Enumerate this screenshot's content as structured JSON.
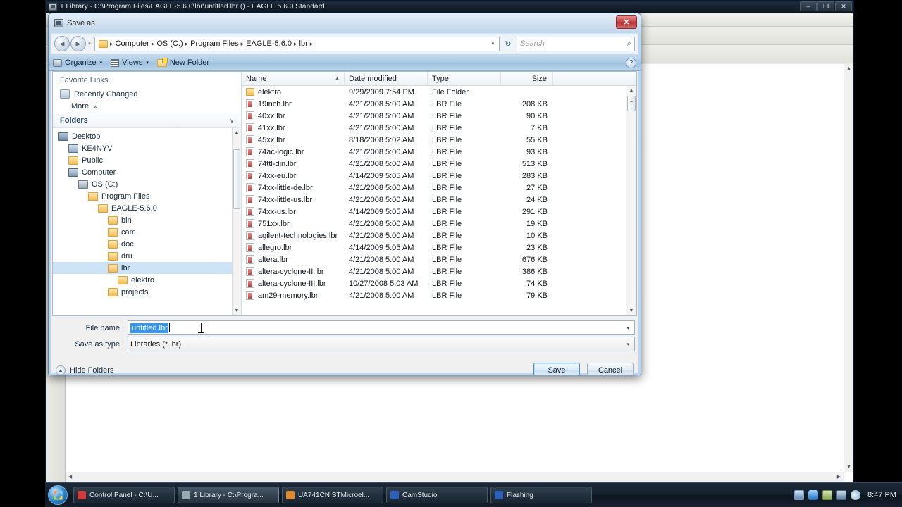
{
  "eagle_window": {
    "title": "1 Library - C:\\Program Files\\EAGLE-5.6.0\\lbr\\untitled.lbr () - EAGLE 5.6.0 Standard",
    "minimize_label": "–",
    "maximize_label": "❐",
    "close_label": "✕"
  },
  "dialog": {
    "title": "Save as",
    "close_label": "✕",
    "nav": {
      "back_label": "◀",
      "forward_label": "▶",
      "history_label": "▾",
      "refresh_label": "↻"
    },
    "breadcrumb": {
      "separator": "▸",
      "items": [
        "Computer",
        "OS (C:)",
        "Program Files",
        "EAGLE-5.6.0",
        "lbr"
      ],
      "dropdown_label": "▾"
    },
    "search": {
      "placeholder": "Search",
      "icon_label": "⌕"
    },
    "commandbar": {
      "organize_label": "Organize",
      "views_label": "Views",
      "new_folder_label": "New Folder",
      "caret_label": "▾",
      "help_label": "?"
    },
    "sidebar": {
      "favorites_header": "Favorite Links",
      "favorites": [
        {
          "label": "Recently Changed"
        }
      ],
      "more_label": "More",
      "more_chevron": "»",
      "folders_header": "Folders",
      "folders_chevron": "∨",
      "tree": [
        {
          "label": "Desktop",
          "depth": 0,
          "icon": "desktop",
          "selected": false
        },
        {
          "label": "KE4NYV",
          "depth": 1,
          "icon": "user",
          "selected": false
        },
        {
          "label": "Public",
          "depth": 1,
          "icon": "folder",
          "selected": false
        },
        {
          "label": "Computer",
          "depth": 1,
          "icon": "computer",
          "selected": false
        },
        {
          "label": "OS (C:)",
          "depth": 2,
          "icon": "drive",
          "selected": false
        },
        {
          "label": "Program Files",
          "depth": 3,
          "icon": "folder",
          "selected": false
        },
        {
          "label": "EAGLE-5.6.0",
          "depth": 4,
          "icon": "folder",
          "selected": false
        },
        {
          "label": "bin",
          "depth": 5,
          "icon": "folder",
          "selected": false
        },
        {
          "label": "cam",
          "depth": 5,
          "icon": "folder",
          "selected": false
        },
        {
          "label": "doc",
          "depth": 5,
          "icon": "folder",
          "selected": false
        },
        {
          "label": "dru",
          "depth": 5,
          "icon": "folder",
          "selected": false
        },
        {
          "label": "lbr",
          "depth": 5,
          "icon": "folder",
          "selected": true
        },
        {
          "label": "elektro",
          "depth": 6,
          "icon": "folder",
          "selected": false
        },
        {
          "label": "projects",
          "depth": 5,
          "icon": "folder",
          "selected": false
        }
      ],
      "scroll_up_label": "▲",
      "scroll_down_label": "▼"
    },
    "filelist": {
      "columns": [
        "Name",
        "Date modified",
        "Type",
        "Size"
      ],
      "sort_indicator": "▲",
      "rows": [
        {
          "name": "elektro",
          "date": "9/29/2009 7:54 PM",
          "type": "File Folder",
          "size": "",
          "icon": "folder"
        },
        {
          "name": "19inch.lbr",
          "date": "4/21/2008 5:00 AM",
          "type": "LBR File",
          "size": "208 KB",
          "icon": "lbr"
        },
        {
          "name": "40xx.lbr",
          "date": "4/21/2008 5:00 AM",
          "type": "LBR File",
          "size": "90 KB",
          "icon": "lbr"
        },
        {
          "name": "41xx.lbr",
          "date": "4/21/2008 5:00 AM",
          "type": "LBR File",
          "size": "7 KB",
          "icon": "lbr"
        },
        {
          "name": "45xx.lbr",
          "date": "8/18/2008 5:02 AM",
          "type": "LBR File",
          "size": "55 KB",
          "icon": "lbr"
        },
        {
          "name": "74ac-logic.lbr",
          "date": "4/21/2008 5:00 AM",
          "type": "LBR File",
          "size": "93 KB",
          "icon": "lbr"
        },
        {
          "name": "74ttl-din.lbr",
          "date": "4/21/2008 5:00 AM",
          "type": "LBR File",
          "size": "513 KB",
          "icon": "lbr"
        },
        {
          "name": "74xx-eu.lbr",
          "date": "4/14/2009 5:05 AM",
          "type": "LBR File",
          "size": "283 KB",
          "icon": "lbr"
        },
        {
          "name": "74xx-little-de.lbr",
          "date": "4/21/2008 5:00 AM",
          "type": "LBR File",
          "size": "27 KB",
          "icon": "lbr"
        },
        {
          "name": "74xx-little-us.lbr",
          "date": "4/21/2008 5:00 AM",
          "type": "LBR File",
          "size": "24 KB",
          "icon": "lbr"
        },
        {
          "name": "74xx-us.lbr",
          "date": "4/14/2009 5:05 AM",
          "type": "LBR File",
          "size": "291 KB",
          "icon": "lbr"
        },
        {
          "name": "751xx.lbr",
          "date": "4/21/2008 5:00 AM",
          "type": "LBR File",
          "size": "19 KB",
          "icon": "lbr"
        },
        {
          "name": "agilent-technologies.lbr",
          "date": "4/21/2008 5:00 AM",
          "type": "LBR File",
          "size": "10 KB",
          "icon": "lbr"
        },
        {
          "name": "allegro.lbr",
          "date": "4/14/2009 5:05 AM",
          "type": "LBR File",
          "size": "23 KB",
          "icon": "lbr"
        },
        {
          "name": "altera.lbr",
          "date": "4/21/2008 5:00 AM",
          "type": "LBR File",
          "size": "676 KB",
          "icon": "lbr"
        },
        {
          "name": "altera-cyclone-II.lbr",
          "date": "4/21/2008 5:00 AM",
          "type": "LBR File",
          "size": "386 KB",
          "icon": "lbr"
        },
        {
          "name": "altera-cyclone-III.lbr",
          "date": "10/27/2008 5:03 AM",
          "type": "LBR File",
          "size": "74 KB",
          "icon": "lbr"
        },
        {
          "name": "am29-memory.lbr",
          "date": "4/21/2008 5:00 AM",
          "type": "LBR File",
          "size": "79 KB",
          "icon": "lbr"
        }
      ],
      "scroll_up_label": "▲",
      "scroll_down_label": "▼"
    },
    "fields": {
      "filename_label": "File name:",
      "filename_value": "untitled.lbr",
      "filetype_label": "Save as type:",
      "filetype_value": "Libraries (*.lbr)",
      "dropdown_label": "▾"
    },
    "footer": {
      "hide_folders_label": "Hide Folders",
      "hide_folders_chevron": "▲",
      "save_label": "Save",
      "cancel_label": "Cancel"
    }
  },
  "taskbar": {
    "start_label": "Start",
    "tasks": [
      {
        "label": "Control Panel - C:\\U...",
        "icon_color": "#cf3b3b",
        "active": false
      },
      {
        "label": "1 Library - C:\\Progra...",
        "icon_color": "#9aa8b6",
        "active": true
      },
      {
        "label": "UA741CN STMicroel...",
        "icon_color": "#e08a2e",
        "active": false
      },
      {
        "label": "CamStudio",
        "icon_color": "#2b5fb8",
        "active": false
      },
      {
        "label": "Flashing",
        "icon_color": "#2b5fb8",
        "active": false
      }
    ],
    "tray": {
      "icons": [
        "monitor-icon",
        "bluetooth-icon",
        "battery-icon",
        "network-icon",
        "volume-icon"
      ],
      "time": "8:47 PM"
    }
  }
}
